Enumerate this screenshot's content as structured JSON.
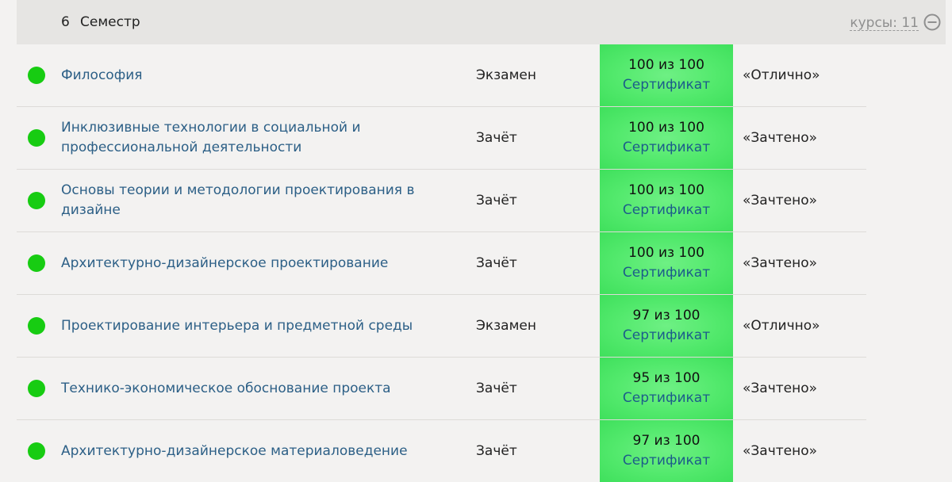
{
  "semester": {
    "number": "6",
    "title": "Семестр",
    "courses_count_label": "курсы: 11"
  },
  "icons": {
    "collapse": "minus-circle-icon",
    "status": "status-dot-icon"
  },
  "colors": {
    "status_green": "#17cc12",
    "score_bg": "#52e96c",
    "link": "#2c5f86"
  },
  "courses": [
    {
      "name": "Философия",
      "type": "Экзамен",
      "score": "100 из 100",
      "certificate": "Сертификат",
      "grade": "«Отлично»"
    },
    {
      "name": "Инклюзивные технологии в социальной и профессиональной деятельности",
      "type": "Зачёт",
      "score": "100 из 100",
      "certificate": "Сертификат",
      "grade": "«Зачтено»"
    },
    {
      "name": "Основы теории и методологии проектирования в дизайне",
      "type": "Зачёт",
      "score": "100 из 100",
      "certificate": "Сертификат",
      "grade": "«Зачтено»"
    },
    {
      "name": "Архитектурно-дизайнерское проектирование",
      "type": "Зачёт",
      "score": "100 из 100",
      "certificate": "Сертификат",
      "grade": "«Зачтено»"
    },
    {
      "name": "Проектирование интерьера и предметной среды",
      "type": "Экзамен",
      "score": "97 из 100",
      "certificate": "Сертификат",
      "grade": "«Отлично»"
    },
    {
      "name": "Технико-экономическое обоснование проекта",
      "type": "Зачёт",
      "score": "95 из 100",
      "certificate": "Сертификат",
      "grade": "«Зачтено»"
    },
    {
      "name": "Архитектурно-дизайнерское материаловедение",
      "type": "Зачёт",
      "score": "97 из 100",
      "certificate": "Сертификат",
      "grade": "«Зачтено»"
    }
  ]
}
